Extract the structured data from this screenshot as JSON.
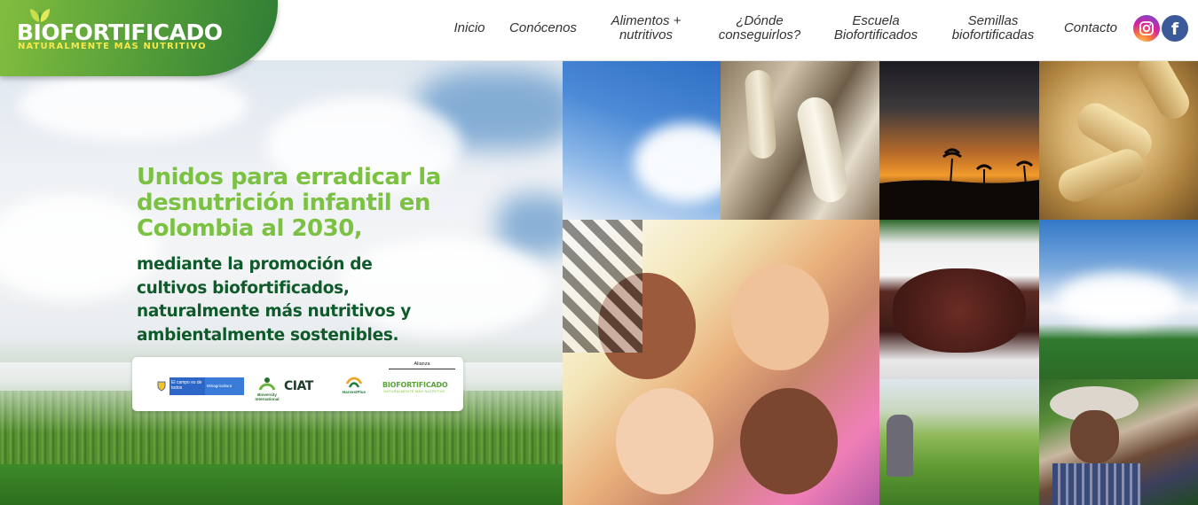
{
  "brand": {
    "name": "BIOFORTIFICADO",
    "tagline": "NATURALMENTE MÁS NUTRITIVO"
  },
  "nav": {
    "items": [
      {
        "label": "Inicio"
      },
      {
        "label": "Conócenos"
      },
      {
        "label": "Alimentos +\nnutritivos"
      },
      {
        "label": "¿Dónde\nconseguirlos?"
      },
      {
        "label": "Escuela\nBiofortificados"
      },
      {
        "label": "Semillas\nbiofortificadas"
      },
      {
        "label": "Contacto"
      }
    ],
    "social": [
      {
        "icon": "instagram-icon"
      },
      {
        "icon": "facebook-icon",
        "glyph": "f"
      }
    ]
  },
  "hero": {
    "headline": "Unidos para erradicar la desnutrición infantil en Colombia al 2030,",
    "subline": "mediante la promoción de cultivos biofortificados, naturalmente más nutritivos y ambientalmente sostenibles."
  },
  "partners": {
    "alianza": "Alianza",
    "minagricultura": "El campo es de todos",
    "minagricultura_sub": "Minagricultura",
    "bioversity": "Bioversity International",
    "ciat": "CIAT",
    "harvestplus": "HarvestPlus",
    "biofortificado": "BIOFORTIFICADO",
    "biofortificado_sub": "NATURALMENTE MÁS NUTRITIVO"
  },
  "colors": {
    "brand_green": "#5aa23a",
    "headline_green": "#7bc142",
    "subline_green": "#0f5a2a",
    "tagline_yellow": "#f2e94e",
    "facebook_blue": "#3b5998"
  },
  "gallery": [
    {
      "subject": "sky-and-clouds"
    },
    {
      "subject": "corn-husks"
    },
    {
      "subject": "sunset-palm-trees"
    },
    {
      "subject": "corn-cobs"
    },
    {
      "subject": "smiling-children"
    },
    {
      "subject": "sack-of-beans"
    },
    {
      "subject": "crop-field-sky"
    },
    {
      "subject": "farmer-in-field"
    },
    {
      "subject": "farmer-portrait"
    }
  ]
}
